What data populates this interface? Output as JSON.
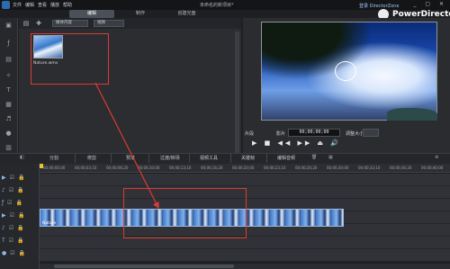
{
  "app": {
    "menu": [
      "文件",
      "编辑",
      "查看",
      "播放",
      "帮助"
    ],
    "document_title": "未命名的新项目*",
    "login_link": "登录 DirectorZone",
    "brand_name": "PowerDirector",
    "window_controls": "_ ▢ ✕"
  },
  "mode_tabs": {
    "edit": "编辑",
    "produce": "制作",
    "disc": "创建光盘"
  },
  "library": {
    "filter_dropdown": "媒体内容",
    "type_dropdown": "视频",
    "items": [
      {
        "label": "Nature.wmv"
      }
    ]
  },
  "preview": {
    "mode_clip": "片段",
    "mode_movie": "影片",
    "timecode": "00;00;00;00",
    "zoom_label": "调整大小",
    "transport": "▶ ■ ◀◀ ▶▶ ⏏ 🔊"
  },
  "timeline_toolbar": {
    "buttons": [
      "分割",
      "修剪",
      "预览",
      "过渡/转场",
      "视频工具",
      "关键帧",
      "编辑音频"
    ]
  },
  "ruler": {
    "labels": [
      "00;00;00;00",
      "00;00;03;10",
      "00;00;06;20",
      "00;00;10;00",
      "00;00;13;10",
      "00;00;16;20",
      "00;00;20;00",
      "00;00;23;10",
      "00;00;26;20",
      "00;00;30;00",
      "00;00;33;10",
      "00;00;36;20",
      "00;00;40;00"
    ]
  },
  "timeline": {
    "clip_name": "Nature"
  },
  "colors": {
    "highlight_box": "#e03a2e",
    "accent": "#4c5058"
  }
}
